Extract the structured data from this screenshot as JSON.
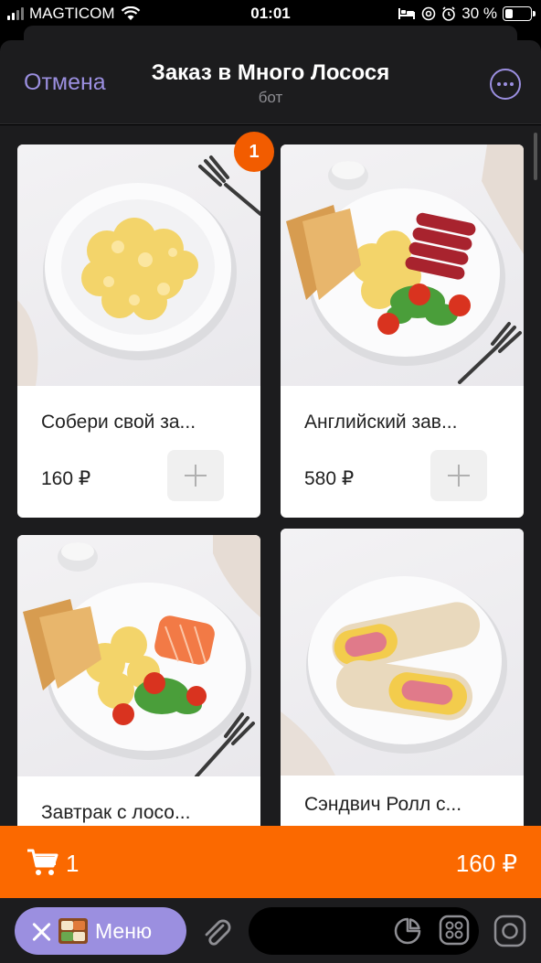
{
  "status_bar": {
    "carrier": "MAGTICOM",
    "time": "01:01",
    "battery": "30 %",
    "battery_level": 0.3
  },
  "header": {
    "cancel_label": "Отмена",
    "title": "Заказ в Много Лосося",
    "subtitle": "бот"
  },
  "products": [
    {
      "name": "Собери свой за...",
      "price": "160 ₽",
      "badge": "1"
    },
    {
      "name": "Английский зав...",
      "price": "580 ₽"
    },
    {
      "name": "Завтрак с лосо..."
    },
    {
      "name": "Сэндвич Ролл с..."
    }
  ],
  "cart": {
    "count": "1",
    "total": "160 ₽"
  },
  "bottom_bar": {
    "menu_label": "Меню"
  },
  "colors": {
    "accent": "#9b8fe0",
    "cart_bar": "#fb6900",
    "badge": "#f25c00",
    "background": "#1c1c1e"
  }
}
